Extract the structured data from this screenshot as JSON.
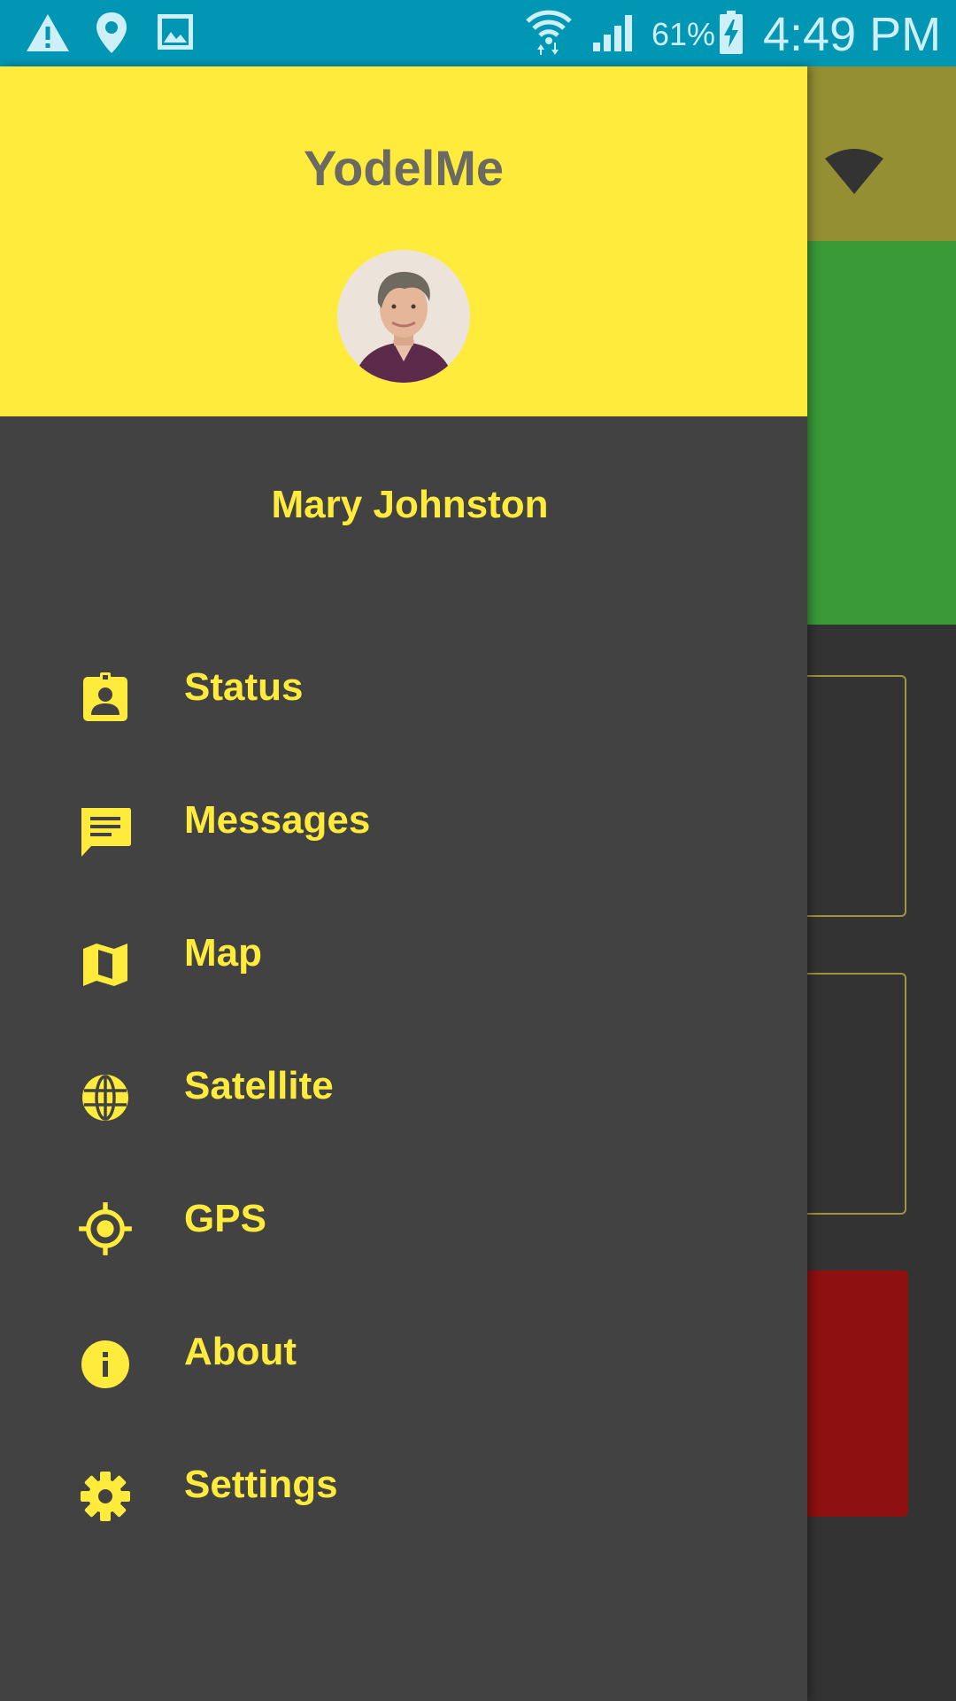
{
  "status_bar": {
    "icons_left": [
      "warning-icon",
      "location-pin-icon",
      "image-icon"
    ],
    "icons_right": [
      "wifi-icon",
      "cell-signal-icon",
      "battery-charging-icon"
    ],
    "battery_percent": "61%",
    "time": "4:49 PM",
    "background_color": "#0096B4"
  },
  "drawer": {
    "app_title": "YodelMe",
    "header_color": "#FFEB3B",
    "background_color": "#424242",
    "avatar": "user-avatar-photo",
    "user_name": "Mary Johnston",
    "items": [
      {
        "label": "Status",
        "icon": "badge-icon"
      },
      {
        "label": "Messages",
        "icon": "message-icon"
      },
      {
        "label": "Map",
        "icon": "map-icon"
      },
      {
        "label": "Satellite",
        "icon": "globe-icon"
      },
      {
        "label": "GPS",
        "icon": "gps-crosshair-icon"
      },
      {
        "label": "About",
        "icon": "info-icon"
      },
      {
        "label": "Settings",
        "icon": "gear-icon"
      }
    ]
  },
  "background_app": {
    "colors": {
      "top_bar": "#948F33",
      "status_panel": "#3A9A37",
      "body": "#333333",
      "alert_button": "#8E1010"
    }
  }
}
